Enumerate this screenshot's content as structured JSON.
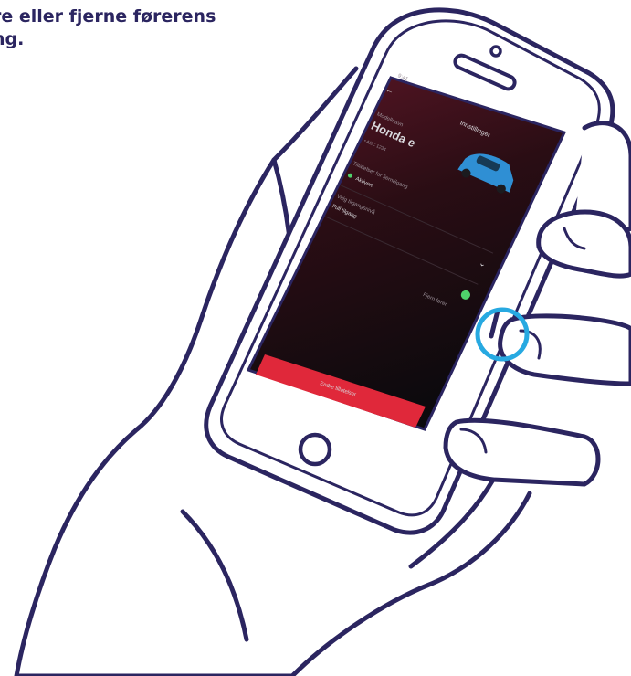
{
  "caption": {
    "line1": "re eller fjerne førerens",
    "line2": "ng."
  },
  "app": {
    "header_title": "Innstillinger",
    "model_label": "Modellnavn",
    "vehicle_name": "Honda e",
    "vehicle_id": "• ABC 1234",
    "permissions_label": "Tillatelser for fjerntilgang",
    "permission_value": "Aktivert",
    "dropdown_label": "Velg tilgangsnivå",
    "dropdown_value": "Full tilgang",
    "toggle_label": "Fjern fører",
    "primary_button": "Endre tillatelser"
  },
  "colors": {
    "line": "#2b2560",
    "accent": "#27a9e1",
    "button": "#e0283a",
    "toggle": "#4fd26b",
    "screen_top": "#5a1626",
    "screen_bottom": "#0c0a0d",
    "car": "#2f8fd4"
  }
}
